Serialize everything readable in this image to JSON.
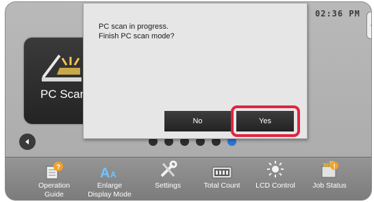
{
  "status_bar": {
    "time": "02:36 PM"
  },
  "app_tile": {
    "label": "PC Scan",
    "icon": "scanner-icon"
  },
  "pagination": {
    "count": 6,
    "active_index": 5
  },
  "dialog": {
    "message_line1": "PC scan in progress.",
    "message_line2": "Finish PC scan mode?",
    "no_label": "No",
    "yes_label": "Yes",
    "highlight_color": "#e0243f"
  },
  "toolbar": {
    "items": [
      {
        "label_line1": "Operation",
        "label_line2": "Guide",
        "icon": "operation-guide-icon"
      },
      {
        "label_line1": "Enlarge",
        "label_line2": "Display Mode",
        "icon": "enlarge-display-icon"
      },
      {
        "label_line1": "Settings",
        "label_line2": "",
        "icon": "settings-icon"
      },
      {
        "label_line1": "Total Count",
        "label_line2": "",
        "icon": "total-count-icon"
      },
      {
        "label_line1": "LCD Control",
        "label_line2": "",
        "icon": "lcd-control-icon"
      },
      {
        "label_line1": "Job Status",
        "label_line2": "",
        "icon": "job-status-icon"
      }
    ]
  }
}
